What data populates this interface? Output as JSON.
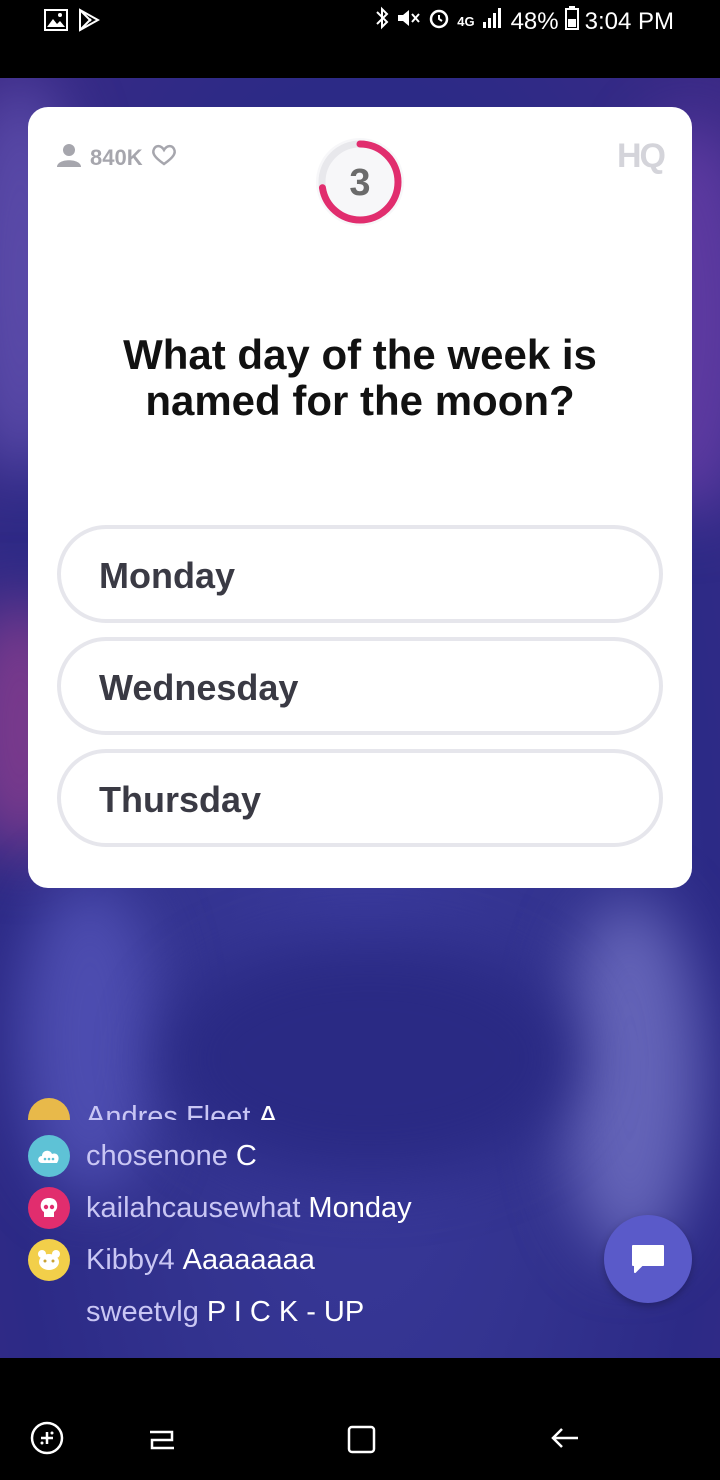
{
  "status": {
    "network": "4G",
    "battery": "48%",
    "time": "3:04 PM"
  },
  "header": {
    "viewer_count": "840K",
    "logo": "HQ",
    "timer": "3"
  },
  "question": "What day of the week is named for the moon?",
  "options": [
    "Monday",
    "Wednesday",
    "Thursday"
  ],
  "chat": {
    "partial": {
      "user": "Andres Fleet",
      "message": "A"
    },
    "messages": [
      {
        "user": "chosenone",
        "message": "C",
        "avatar_color": "#5ec2d6"
      },
      {
        "user": "kailahcausewhat",
        "message": "Monday",
        "avatar_color": "#e12d6e"
      },
      {
        "user": "Kibby4",
        "message": "Aaaaaaaa",
        "avatar_color": "#f2cf4a"
      },
      {
        "user": "sweetvlg",
        "message": "P I C K - UP",
        "avatar_color": ""
      }
    ]
  },
  "colors": {
    "accent": "#e12d6e",
    "stage": "#33338f",
    "chat_button": "#5a5ac9"
  }
}
